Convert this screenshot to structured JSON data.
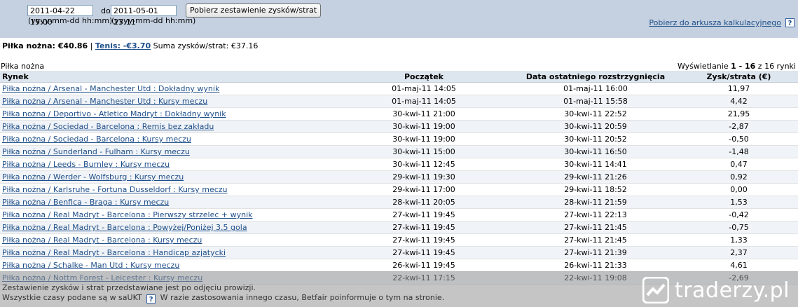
{
  "filter": {
    "from_value": "2011-04-22 19:00",
    "to_label": "do",
    "to_value": "2011-05-01 23:11",
    "from_format": "(yyyy-mm-dd hh:mm)",
    "to_format": "(yyyy-mm-dd hh:mm)",
    "submit_label": "Pobierz zestawienie zysków/strat"
  },
  "export": {
    "link_label": "Pobierz do arkusza kalkulacyjnego",
    "help_glyph": "?"
  },
  "summary": {
    "football_label": "Piłka nożna: €40.86",
    "separator": "|",
    "tennis_label": "Tenis: -€3.70",
    "total_label": "Suma zysków/strat:",
    "total_value": "€37.16"
  },
  "section": {
    "title": "Piłka nożna",
    "paging_prefix": "Wyświetlanie ",
    "paging_range": "1 - 16",
    "paging_suffix": " z 16 rynki"
  },
  "table": {
    "headers": {
      "market": "Rynek",
      "start": "Początek",
      "settled": "Data ostatniego rozstrzygnięcia",
      "pl": "Zysk/strata (€)"
    },
    "rows": [
      {
        "market": "Piłka nożna / Arsenal - Manchester Utd : Dokładny wynik",
        "start": "01-maj-11 14:05",
        "settled": "01-maj-11 16:00",
        "pl": "11,97"
      },
      {
        "market": "Piłka nożna / Arsenal - Manchester Utd : Kursy meczu",
        "start": "01-maj-11 14:05",
        "settled": "01-maj-11 15:58",
        "pl": "4,42"
      },
      {
        "market": "Piłka nożna / Deportivo - Atletico Madryt : Dokładny wynik",
        "start": "30-kwi-11 21:00",
        "settled": "30-kwi-11 22:52",
        "pl": "21,95"
      },
      {
        "market": "Piłka nożna / Sociedad - Barcelona : Remis bez zakładu",
        "start": "30-kwi-11 19:00",
        "settled": "30-kwi-11 20:59",
        "pl": "-2,87"
      },
      {
        "market": "Piłka nożna / Sociedad - Barcelona : Kursy meczu",
        "start": "30-kwi-11 19:00",
        "settled": "30-kwi-11 20:52",
        "pl": "-0,50"
      },
      {
        "market": "Piłka nożna / Sunderland - Fulham : Kursy meczu",
        "start": "30-kwi-11 15:00",
        "settled": "30-kwi-11 16:50",
        "pl": "-1,48"
      },
      {
        "market": "Piłka nożna / Leeds - Burnley : Kursy meczu",
        "start": "30-kwi-11 12:45",
        "settled": "30-kwi-11 14:41",
        "pl": "0,47"
      },
      {
        "market": "Piłka nożna / Werder - Wolfsburg : Kursy meczu",
        "start": "29-kwi-11 19:30",
        "settled": "29-kwi-11 21:26",
        "pl": "0,92"
      },
      {
        "market": "Piłka nożna / Karlsruhe - Fortuna Dusseldorf : Kursy meczu",
        "start": "29-kwi-11 17:00",
        "settled": "29-kwi-11 18:52",
        "pl": "0,00"
      },
      {
        "market": "Piłka nożna / Benfica - Braga : Kursy meczu",
        "start": "28-kwi-11 20:05",
        "settled": "28-kwi-11 21:59",
        "pl": "1,53"
      },
      {
        "market": "Piłka nożna / Real Madryt - Barcelona : Pierwszy strzelec + wynik",
        "start": "27-kwi-11 19:45",
        "settled": "27-kwi-11 22:13",
        "pl": "-0,42"
      },
      {
        "market": "Piłka nożna / Real Madryt - Barcelona : Powyżej/Poniżej 3.5 gola",
        "start": "27-kwi-11 19:45",
        "settled": "27-kwi-11 21:45",
        "pl": "-0,75"
      },
      {
        "market": "Piłka nożna / Real Madryt - Barcelona : Kursy meczu",
        "start": "27-kwi-11 19:45",
        "settled": "27-kwi-11 21:45",
        "pl": "1,33"
      },
      {
        "market": "Piłka nożna / Real Madryt - Barcelona : Handicap azjatycki",
        "start": "27-kwi-11 19:45",
        "settled": "27-kwi-11 21:39",
        "pl": "2,37"
      },
      {
        "market": "Piłka nożna / Schalke - Man Utd : Kursy meczu",
        "start": "26-kwi-11 19:45",
        "settled": "26-kwi-11 21:33",
        "pl": "4,61"
      },
      {
        "market": "Piłka nożna / Nottm Forest - Leicester : Kursy meczu",
        "start": "22-kwi-11 17:15",
        "settled": "22-kwi-11 19:08",
        "pl": "-2,69"
      }
    ]
  },
  "footer": {
    "note1": "Zestawienie zysków i strat przedstawiane jest po odjęciu prowizji.",
    "note2_a": "Wszystkie czasy podane są w saUKT",
    "note2_help": "?",
    "note2_b": "W razie zastosowania innego czasu, Betfair poinformuje o tym na stronie.",
    "logo_text": "traderzy.pl"
  },
  "colors": {
    "topbar": "#c5d1e0",
    "link": "#1f4f8a",
    "header_row": "#dde5ee",
    "alt_row": "#f0f3f7"
  }
}
